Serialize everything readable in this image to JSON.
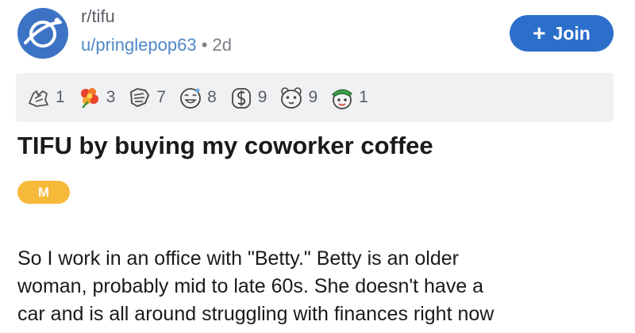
{
  "post": {
    "subreddit": "r/tifu",
    "author": "u/pringlepop63",
    "separator": "•",
    "age": "2d",
    "join_label": "Join",
    "join_icon": "plus-icon",
    "title": "TIFU by buying my coworker coffee",
    "flair": "M",
    "body_lines": [
      "So I work in an office with \"Betty.\" Betty is an older",
      "woman, probably mid to late 60s. She doesn't have a",
      "car and is all around struggling with finances right now"
    ]
  },
  "awards": [
    {
      "icon": "silver-hand-award-icon",
      "count": "1"
    },
    {
      "icon": "flower-award-icon",
      "count": "3"
    },
    {
      "icon": "helpful-hand-award-icon",
      "count": "7"
    },
    {
      "icon": "laughing-face-award-icon",
      "count": "8"
    },
    {
      "icon": "dollar-coin-award-icon",
      "count": "9"
    },
    {
      "icon": "hamster-award-icon",
      "count": "9"
    },
    {
      "icon": "green-hat-face-award-icon",
      "count": "1"
    }
  ],
  "colors": {
    "accent": "#2c6fcb",
    "author_link": "#4f88c9",
    "flair": "#f7b93a",
    "award_bar": "#f0f1f3",
    "avatar": "#3d73c4"
  }
}
